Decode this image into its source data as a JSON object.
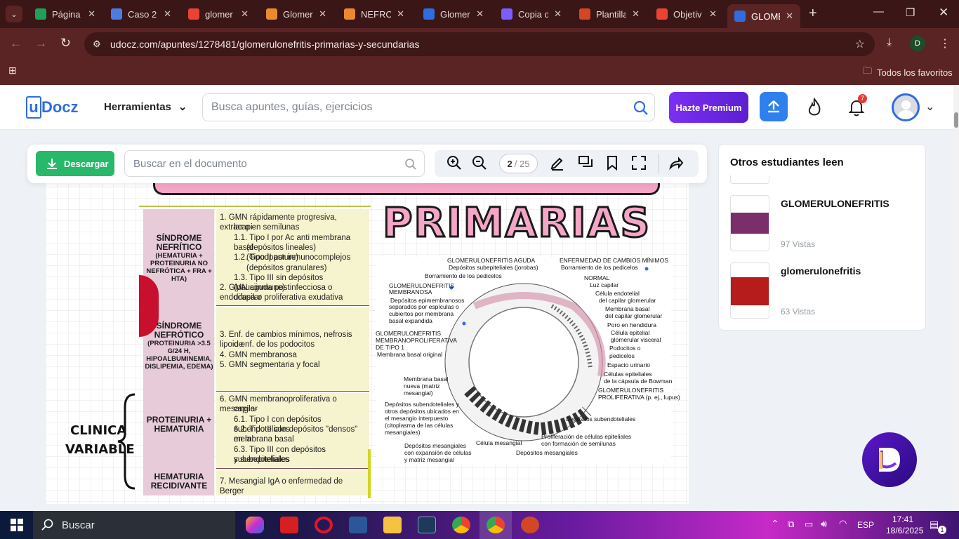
{
  "browser": {
    "tabs": [
      {
        "label": "Página",
        "color": "#1f9f5a"
      },
      {
        "label": "Caso 2",
        "color": "#4a7de0"
      },
      {
        "label": "glomer",
        "color": "#ea4335"
      },
      {
        "label": "Glomer",
        "color": "#ea8a30"
      },
      {
        "label": "NEFROI",
        "color": "#ea8a30"
      },
      {
        "label": "Glomer",
        "color": "#2f6ddf"
      },
      {
        "label": "Copia d",
        "color": "#7a5cff"
      },
      {
        "label": "Plantilla",
        "color": "#d24726"
      },
      {
        "label": "Objetiv",
        "color": "#ea4335"
      },
      {
        "label": "GLOME",
        "color": "#2f6ddf"
      }
    ],
    "url": "udocz.com/apuntes/1278481/glomerulonefritis-primarias-y-secundarias",
    "bookmarks_label": "Todos los favoritos",
    "profile_initial": "D"
  },
  "header": {
    "logo": "Docz",
    "logo_u": "u",
    "tools_label": "Herramientas",
    "search_placeholder": "Busca apuntes, guías, ejercicios",
    "premium_label": "Hazte Premium",
    "notif_count": "7"
  },
  "toolbar": {
    "download_label": "Descargar",
    "doc_search_placeholder": "Buscar en el documento",
    "page_current": "2",
    "page_total": "/ 25"
  },
  "sidebar": {
    "title": "Otros estudiantes leen",
    "items": [
      {
        "title": "GLOMERULONEFRITIS",
        "views": "97 Vistas",
        "thumb_color": "#7b2f6a"
      },
      {
        "title": "glomerulonefritis",
        "views": "63 Vistas",
        "thumb_color": "#b71c1c"
      }
    ]
  },
  "document": {
    "heading": "PRIMARIAS",
    "side_label_1": "CLINICA",
    "side_label_2": "VARIABLE",
    "rows": [
      {
        "syndrome": "SÍNDROME NEFRÍTICO",
        "detail": "(HEMATURIA + PROTEINURIA NO NEFRÓTICA + FRA + HTA)",
        "lines": [
          "1. GMN rápidamente progresiva, extracapi-",
          "lar o en semilunas",
          "1.1. Tipo I por Ac anti membrana basal",
          "(depósitos lineales) (Goodpasture)",
          "1.2. Tipo II por inmunocomplejos",
          "(depósitos granulares)",
          "1.3. Tipo III sin depósitos (pauciinmune)",
          "2. GMN aguda postinfecciosa o endocapilar",
          "difusa o proliferativa exudativa"
        ]
      },
      {
        "syndrome": "SÍNDROME NEFRÓTICO",
        "detail": "(PROTEINURIA >3.5 G/24 H, HIPOALBUMINEMIA, DISLIPEMIA, EDEMA)",
        "lines": [
          "3. Enf. de cambios mínimos, nefrosis lipoide",
          "o enf. de los podocitos",
          "4. GMN membranosa",
          "5. GMN segmentaria y focal"
        ]
      },
      {
        "syndrome": "PROTEINURIA + HEMATURIA",
        "detail": "",
        "lines": [
          "6. GMN membranoproliferativa o mesangio-",
          "capilar",
          "6.1. Tipo I con depósitos subendoteliales",
          "6.2. Tipo II con depósitos \"densos\" en la",
          "membrana basal",
          "6.3. Tipo III con depósitos subendoteliales",
          "y subepiteliales"
        ]
      },
      {
        "syndrome": "HEMATURIA RECIDIVANTE",
        "detail": "",
        "lines": [
          "7. Mesangial IgA o enfermedad de Berger"
        ]
      }
    ],
    "diagram_labels": {
      "l1": "GLOMERULONEFRITIS AGUDA",
      "l2": "Depósitos subepiteliales (jorobas)",
      "l3": "Borramiento de los pedicelos",
      "l4": "ENFERMEDAD DE CAMBIOS MÍNIMOS",
      "l5": "Borramiento de los pedicelos",
      "l6": "NORMAL",
      "l7": "Luz capilar",
      "l8": "Célula endotelial",
      "l9": "del capilar glomerular",
      "l10": "Membrana basal",
      "l11": "del capilar glomerular",
      "l12": "Poro en hendidura",
      "l13": "Célula epitelial",
      "l14": "glomerular visceral",
      "l15": "Podocitos o",
      "l16": "pedicelos",
      "l17": "Espacio urinario",
      "l18": "Células epiteliales",
      "l19": "de la cápsula de Bowman",
      "l20": "GLOMERULONEFRITIS",
      "l21": "PROLIFERATIVA (p. ej., lupus)",
      "l22": "Depósitos subendoteliales",
      "l23": "GLOMERULONEFRITIS",
      "l24": "MEMBRANOSA",
      "l25": "Depósitos epimembranosos",
      "l26": "separados por espículas o",
      "l27": "cubiertos por membrana",
      "l28": "basal expandida",
      "l29": "GLOMERULONEFRITIS",
      "l30": "MEMBRANOPROLIFERATIVA",
      "l31": "DE TIPO 1",
      "l32": "Membrana basal original",
      "l33": "Membrana basal",
      "l34": "nueva (matriz",
      "l35": "mesangial)",
      "l36": "Depósitos subendoteliales y",
      "l37": "otros depósitos ubicados en",
      "l38": "el mesangio interpuesto",
      "l39": "(citoplasma de las células",
      "l40": "mesangiales)",
      "l41": "Depósitos mesangiales",
      "l42": "con expansión de células",
      "l43": "y matriz mesangial",
      "l44": "Célula mesangial",
      "l45": "Depósitos mesangiales",
      "l46": "Proliferación de células epiteliales",
      "l47": "con formación de semilunas"
    }
  },
  "taskbar": {
    "search_label": "Buscar",
    "lang": "ESP",
    "time": "17:41",
    "date": "18/6/2025",
    "notif": "1"
  }
}
